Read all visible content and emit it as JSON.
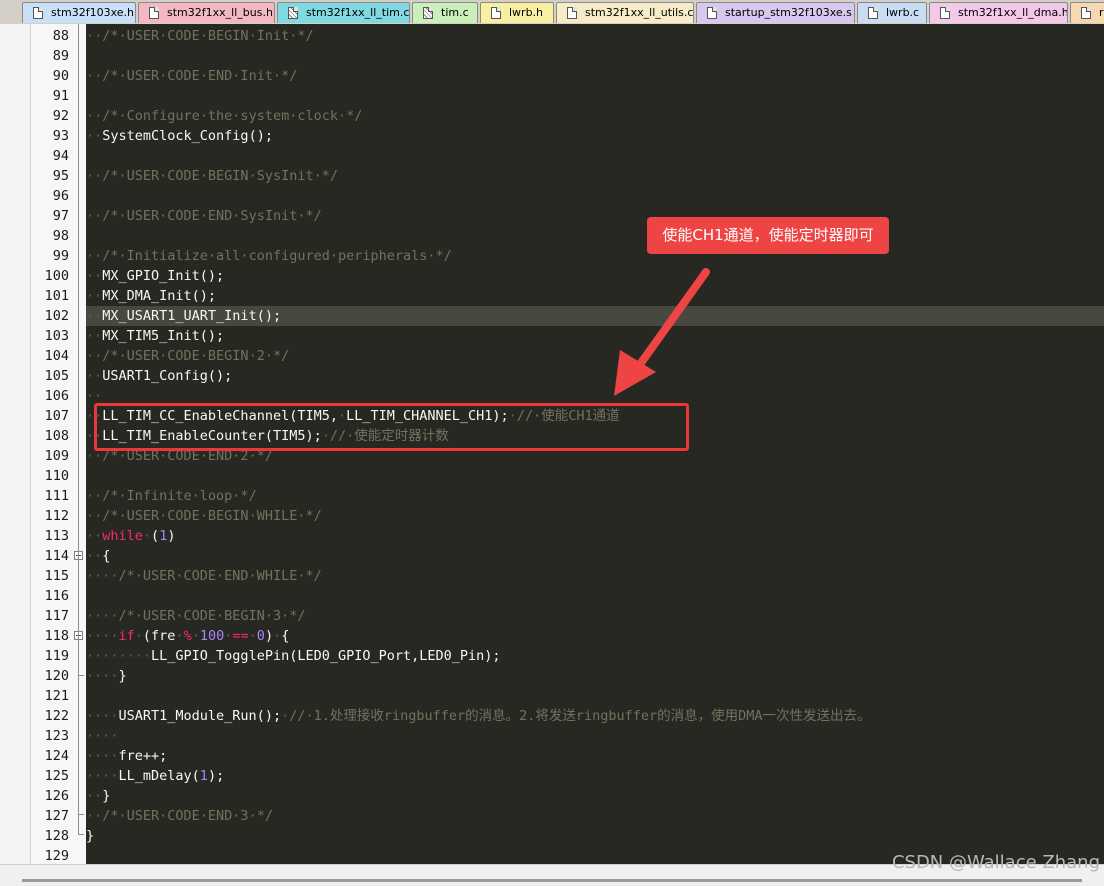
{
  "tabs": [
    {
      "label": "stm32f103xe.h",
      "color": "#c8e0f8",
      "icon": "file-icon"
    },
    {
      "label": "stm32f1xx_ll_bus.h",
      "color": "#f4b8c4",
      "icon": "file-icon"
    },
    {
      "label": "stm32f1xx_ll_tim.c",
      "color": "#80d8e0",
      "icon": "modified-file-icon"
    },
    {
      "label": "tim.c",
      "color": "#c8f0b8",
      "icon": "modified-file-icon"
    },
    {
      "label": "lwrb.h",
      "color": "#f8f0a0",
      "icon": "file-icon"
    },
    {
      "label": "stm32f1xx_ll_utils.c",
      "color": "#f8ecc8",
      "icon": "file-icon"
    },
    {
      "label": "startup_stm32f103xe.s",
      "color": "#d8c8f0",
      "icon": "file-icon"
    },
    {
      "label": "lwrb.c",
      "color": "#c8dcf4",
      "icon": "file-icon"
    },
    {
      "label": "stm32f1xx_ll_dma.h",
      "color": "#f4c8e8",
      "icon": "file-icon"
    },
    {
      "label": "r",
      "color": "#f8d8b0",
      "icon": "file-icon"
    }
  ],
  "code_lines": [
    {
      "n": "88",
      "t": "··/*·USER·CODE·BEGIN·Init·*/"
    },
    {
      "n": "89",
      "t": ""
    },
    {
      "n": "90",
      "t": "··/*·USER·CODE·END·Init·*/"
    },
    {
      "n": "91",
      "t": ""
    },
    {
      "n": "92",
      "t": "··/*·Configure·the·system·clock·*/"
    },
    {
      "n": "93",
      "t": "··SystemClock_Config();"
    },
    {
      "n": "94",
      "t": ""
    },
    {
      "n": "95",
      "t": "··/*·USER·CODE·BEGIN·SysInit·*/"
    },
    {
      "n": "96",
      "t": ""
    },
    {
      "n": "97",
      "t": "··/*·USER·CODE·END·SysInit·*/"
    },
    {
      "n": "98",
      "t": ""
    },
    {
      "n": "99",
      "t": "··/*·Initialize·all·configured·peripherals·*/"
    },
    {
      "n": "100",
      "t": "··MX_GPIO_Init();"
    },
    {
      "n": "101",
      "t": "··MX_DMA_Init();"
    },
    {
      "n": "102",
      "t": "··MX_USART1_UART_Init();"
    },
    {
      "n": "103",
      "t": "··MX_TIM5_Init();"
    },
    {
      "n": "104",
      "t": "··/*·USER·CODE·BEGIN·2·*/"
    },
    {
      "n": "105",
      "t": "··USART1_Config();"
    },
    {
      "n": "106",
      "t": "··"
    },
    {
      "n": "107",
      "t": "··LL_TIM_CC_EnableChannel(TIM5,·LL_TIM_CHANNEL_CH1);·//·使能CH1通道"
    },
    {
      "n": "108",
      "t": "··LL_TIM_EnableCounter(TIM5);·//·使能定时器计数"
    },
    {
      "n": "109",
      "t": "··/*·USER·CODE·END·2·*/"
    },
    {
      "n": "110",
      "t": ""
    },
    {
      "n": "111",
      "t": "··/*·Infinite·loop·*/"
    },
    {
      "n": "112",
      "t": "··/*·USER·CODE·BEGIN·WHILE·*/"
    },
    {
      "n": "113",
      "t": "··while·(1)"
    },
    {
      "n": "114",
      "t": "··{"
    },
    {
      "n": "115",
      "t": "····/*·USER·CODE·END·WHILE·*/"
    },
    {
      "n": "116",
      "t": ""
    },
    {
      "n": "117",
      "t": "····/*·USER·CODE·BEGIN·3·*/"
    },
    {
      "n": "118",
      "t": "····if·(fre·%·100·==·0)·{"
    },
    {
      "n": "119",
      "t": "········LL_GPIO_TogglePin(LED0_GPIO_Port,LED0_Pin);"
    },
    {
      "n": "120",
      "t": "····}"
    },
    {
      "n": "121",
      "t": ""
    },
    {
      "n": "122",
      "t": "····USART1_Module_Run();·//·1.处理接收ringbuffer的消息。2.将发送ringbuffer的消息，使用DMA一次性发送出去。"
    },
    {
      "n": "123",
      "t": "····"
    },
    {
      "n": "124",
      "t": "····fre++;"
    },
    {
      "n": "125",
      "t": "····LL_mDelay(1);"
    },
    {
      "n": "126",
      "t": "··}"
    },
    {
      "n": "127",
      "t": "··/*·USER·CODE·END·3·*/"
    },
    {
      "n": "128",
      "t": "}"
    },
    {
      "n": "129",
      "t": ""
    }
  ],
  "current_line": "102",
  "annotation": {
    "callout_text": "使能CH1通道，使能定时器即可"
  },
  "watermark": "CSDN @Wallace Zhang",
  "colors": {
    "editor_bg": "#272822",
    "current_line": "#49483e",
    "comment": "#75715e",
    "keyword": "#f92672",
    "number": "#ae81ff",
    "annotation": "#e8383c"
  }
}
